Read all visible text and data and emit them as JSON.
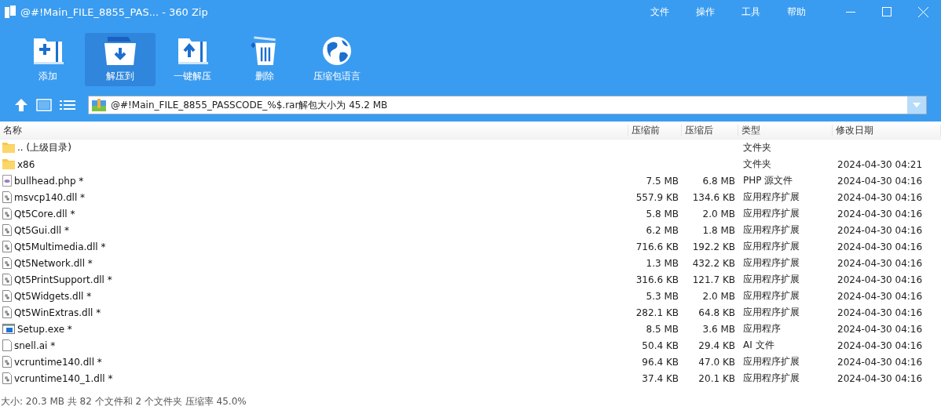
{
  "window": {
    "title": "@#!Main_FILE_8855_PAS... - 360 Zip"
  },
  "menu": [
    "文件",
    "操作",
    "工具",
    "帮助"
  ],
  "toolbar": [
    {
      "kind": "add",
      "label": "添加",
      "selected": false
    },
    {
      "kind": "extract",
      "label": "解压到",
      "selected": true
    },
    {
      "kind": "oneclick",
      "label": "一键解压",
      "selected": false
    },
    {
      "kind": "delete",
      "label": "删除",
      "selected": false
    },
    {
      "kind": "language",
      "label": "压缩包语言",
      "selected": false
    }
  ],
  "address": {
    "value": "@#!Main_FILE_8855_PASSCODE_%$.rar解包大小为 45.2 MB"
  },
  "table": {
    "columns": [
      "名称",
      "压缩前",
      "压缩后",
      "类型",
      "修改日期"
    ],
    "rows": [
      {
        "kind": "folder",
        "name": ".. (上级目录)",
        "before": "",
        "after": "",
        "type": "文件夹",
        "date": ""
      },
      {
        "kind": "folder",
        "name": "x86",
        "type": "文件夹",
        "date": "2024-04-30 04:21"
      },
      {
        "kind": "php",
        "name": "bullhead.php *",
        "before": "7.5 MB",
        "after": "6.8 MB",
        "type": "PHP 源文件",
        "date": "2024-04-30 04:16"
      },
      {
        "kind": "dll",
        "name": "msvcp140.dll *",
        "before": "557.9 KB",
        "after": "134.6 KB",
        "type": "应用程序扩展",
        "date": "2024-04-30 04:16"
      },
      {
        "kind": "dll",
        "name": "Qt5Core.dll *",
        "before": "5.8 MB",
        "after": "2.0 MB",
        "type": "应用程序扩展",
        "date": "2024-04-30 04:16"
      },
      {
        "kind": "dll",
        "name": "Qt5Gui.dll *",
        "before": "6.2 MB",
        "after": "1.8 MB",
        "type": "应用程序扩展",
        "date": "2024-04-30 04:16"
      },
      {
        "kind": "dll",
        "name": "Qt5Multimedia.dll *",
        "before": "716.6 KB",
        "after": "192.2 KB",
        "type": "应用程序扩展",
        "date": "2024-04-30 04:16"
      },
      {
        "kind": "dll",
        "name": "Qt5Network.dll *",
        "before": "1.3 MB",
        "after": "432.2 KB",
        "type": "应用程序扩展",
        "date": "2024-04-30 04:16"
      },
      {
        "kind": "dll",
        "name": "Qt5PrintSupport.dll *",
        "before": "316.6 KB",
        "after": "121.7 KB",
        "type": "应用程序扩展",
        "date": "2024-04-30 04:16"
      },
      {
        "kind": "dll",
        "name": "Qt5Widgets.dll *",
        "before": "5.3 MB",
        "after": "2.0 MB",
        "type": "应用程序扩展",
        "date": "2024-04-30 04:16"
      },
      {
        "kind": "dll",
        "name": "Qt5WinExtras.dll *",
        "before": "282.1 KB",
        "after": "64.8 KB",
        "type": "应用程序扩展",
        "date": "2024-04-30 04:16"
      },
      {
        "kind": "exe",
        "name": "Setup.exe *",
        "before": "8.5 MB",
        "after": "3.6 MB",
        "type": "应用程序",
        "date": "2024-04-30 04:16"
      },
      {
        "kind": "file",
        "name": "snell.ai *",
        "before": "50.4 KB",
        "after": "29.4 KB",
        "type": "AI 文件",
        "date": "2024-04-30 04:16"
      },
      {
        "kind": "dll",
        "name": "vcruntime140.dll *",
        "before": "96.4 KB",
        "after": "47.0 KB",
        "type": "应用程序扩展",
        "date": "2024-04-30 04:16"
      },
      {
        "kind": "dll",
        "name": "vcruntime140_1.dll *",
        "before": "37.4 KB",
        "after": "20.1 KB",
        "type": "应用程序扩展",
        "date": "2024-04-30 04:16"
      }
    ]
  },
  "status_bar": "大小: 20.3 MB 共 82 个文件和 2 个文件夹 压缩率 45.0%"
}
